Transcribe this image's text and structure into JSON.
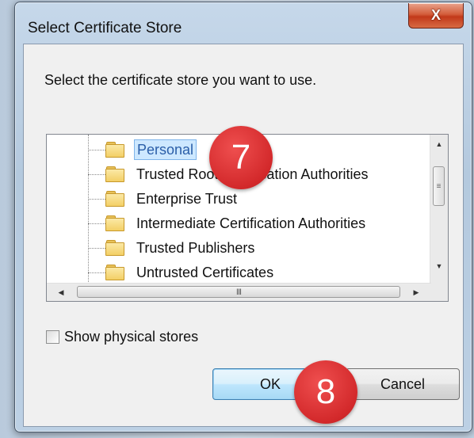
{
  "dialog": {
    "title": "Select Certificate Store",
    "close_label": "X",
    "prompt": "Select the certificate store you want to use."
  },
  "stores": {
    "selected_index": 0,
    "items": [
      {
        "label": "Personal",
        "icon": "folder-icon"
      },
      {
        "label": "Trusted Root Certification Authorities",
        "icon": "folder-icon"
      },
      {
        "label": "Enterprise Trust",
        "icon": "folder-icon"
      },
      {
        "label": "Intermediate Certification Authorities",
        "icon": "folder-icon"
      },
      {
        "label": "Trusted Publishers",
        "icon": "folder-icon"
      },
      {
        "label": "Untrusted Certificates",
        "icon": "folder-icon"
      }
    ]
  },
  "scrollbars": {
    "up": "▲",
    "down": "▼",
    "left": "◀",
    "right": "▶",
    "vthumb_grip": "≡",
    "hthumb_grip": "III"
  },
  "options": {
    "show_physical_label": "Show physical stores",
    "show_physical_checked": false
  },
  "buttons": {
    "ok_label": "OK",
    "cancel_label": "Cancel"
  },
  "annotations": {
    "step7": "7",
    "step8": "8"
  },
  "colors": {
    "selection_bg": "#cde8ff",
    "close_button": "#c2391a",
    "badge": "#d3292b"
  }
}
